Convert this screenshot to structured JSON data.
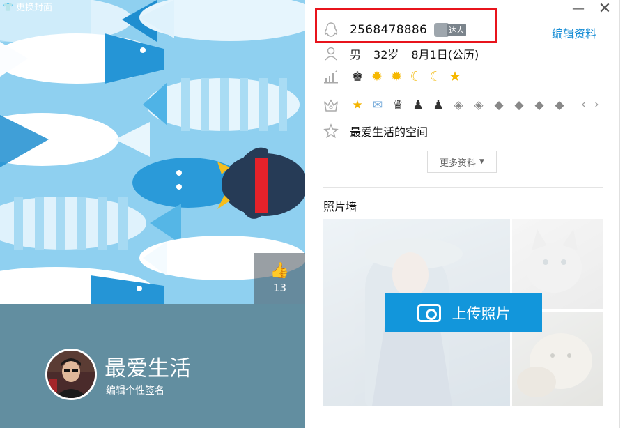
{
  "cover": {
    "change_cover_label": "更换封面",
    "like_count": "13"
  },
  "profile": {
    "nickname": "最爱生活",
    "signature_placeholder": "编辑个性签名"
  },
  "window": {
    "minimize_glyph": "—",
    "close_glyph": "✕"
  },
  "info": {
    "qq_number": "2568478886",
    "daren_badge": "达人",
    "edit_profile_label": "编辑资料",
    "gender": "男",
    "age": "32岁",
    "birthday": "8月1日(公历)",
    "space_name": "最爱生活的空间",
    "more_label": "更多资料"
  },
  "level_icons": [
    "crown",
    "sun",
    "sun",
    "moon",
    "moon",
    "star"
  ],
  "badge_icons": [
    "star-badge",
    "mail-badge",
    "dark-crown-badge",
    "dark-penguin-badge",
    "dark-penguin-badge",
    "diamond-badge",
    "diamond-badge",
    "diamond-badge",
    "diamond-badge",
    "diamond-badge",
    "diamond-badge"
  ],
  "photo_wall": {
    "title": "照片墙",
    "upload_label": "上传照片"
  },
  "colors": {
    "highlight": "#e8141c",
    "accent": "#1a8fd6",
    "upload_button": "#1296db",
    "profile_bar": "#628ea0",
    "cover_bg": "#7dc8ee"
  }
}
